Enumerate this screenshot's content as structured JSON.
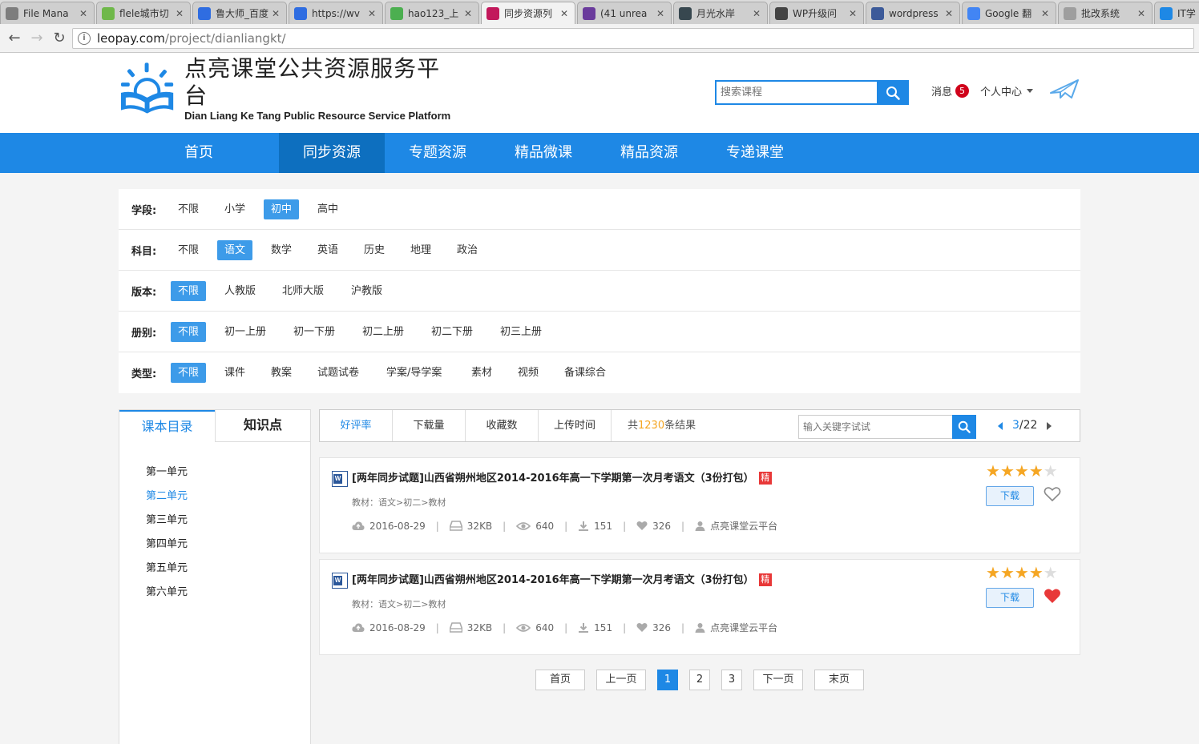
{
  "browser": {
    "tabs": [
      {
        "title": "File Mana",
        "color": "#7d7d7d"
      },
      {
        "title": "flele城市切",
        "color": "#6fb84a"
      },
      {
        "title": "鲁大师_百度",
        "color": "#2f6de1"
      },
      {
        "title": "https://wv",
        "color": "#2f6de1"
      },
      {
        "title": "hao123_上",
        "color": "#4caf50"
      },
      {
        "title": "同步资源列",
        "color": "#c2185b"
      },
      {
        "title": "(41 unrea",
        "color": "#6a3b9c"
      },
      {
        "title": "月光水岸",
        "color": "#37474f"
      },
      {
        "title": "WP升级问",
        "color": "#444444"
      },
      {
        "title": "wordpress",
        "color": "#3c5a99"
      },
      {
        "title": "Google 翻",
        "color": "#4285f4"
      },
      {
        "title": "批改系统",
        "color": "#9e9e9e"
      },
      {
        "title": "IT学",
        "color": "#1e88e5"
      }
    ],
    "active_tab": 5,
    "url_host": "leopay.com",
    "url_path": "/project/dianliangkt/"
  },
  "header": {
    "logo_cn": "点亮课堂公共资源服务平台",
    "logo_en": "Dian Liang Ke Tang Public Resource Service Platform",
    "search_placeholder": "搜索课程",
    "messages_label": "消息",
    "messages_count": "5",
    "user_center": "个人中心"
  },
  "nav": [
    {
      "label": "首页",
      "active": false
    },
    {
      "label": "同步资源",
      "active": true
    },
    {
      "label": "专题资源",
      "active": false
    },
    {
      "label": "精品微课",
      "active": false
    },
    {
      "label": "精品资源",
      "active": false
    },
    {
      "label": "专递课堂",
      "active": false
    }
  ],
  "filters": [
    {
      "label": "学段:",
      "options": [
        "不限",
        "小学",
        "初中",
        "高中"
      ],
      "selected": 2
    },
    {
      "label": "科目:",
      "options": [
        "不限",
        "语文",
        "数学",
        "英语",
        "历史",
        "地理",
        "政治"
      ],
      "selected": 1
    },
    {
      "label": "版本:",
      "options": [
        "不限",
        "人教版",
        "北师大版",
        "沪教版"
      ],
      "selected": 0
    },
    {
      "label": "册别:",
      "options": [
        "不限",
        "初一上册",
        "初一下册",
        "初二上册",
        "初二下册",
        "初三上册"
      ],
      "selected": 0
    },
    {
      "label": "类型:",
      "options": [
        "不限",
        "课件",
        "教案",
        "试题试卷",
        "学案/导学案",
        "素材",
        "视频",
        "备课综合"
      ],
      "selected": 0
    }
  ],
  "sidebar": {
    "tab_catalog": "课本目录",
    "tab_knowledge": "知识点",
    "units": [
      "第一单元",
      "第二单元",
      "第三单元",
      "第四单元",
      "第五单元",
      "第六单元"
    ],
    "selected_unit": 1
  },
  "sortbar": {
    "options": [
      "好评率",
      "下载量",
      "收藏数",
      "上传时间"
    ],
    "selected": 0,
    "total_prefix": "共",
    "total_count": "1230",
    "total_suffix": "条结果",
    "keyword_placeholder": "输入关键字试试",
    "page_current": "3",
    "page_total": "/22"
  },
  "results": [
    {
      "title": "[两年同步试题]山西省朔州地区2014-2016年高一下学期第一次月考语文（3份打包）",
      "badge": "精",
      "path": "教材：语文>初二>教材",
      "date": "2016-08-29",
      "size": "32KB",
      "views": "640",
      "downloads": "151",
      "likes": "326",
      "uploader": "点亮课堂云平台",
      "rating": 4,
      "max_rating": 5,
      "download_label": "下载",
      "favorited": false
    },
    {
      "title": "[两年同步试题]山西省朔州地区2014-2016年高一下学期第一次月考语文（3份打包）",
      "badge": "精",
      "path": "教材：语文>初二>教材",
      "date": "2016-08-29",
      "size": "32KB",
      "views": "640",
      "downloads": "151",
      "likes": "326",
      "uploader": "点亮课堂云平台",
      "rating": 4,
      "max_rating": 5,
      "download_label": "下载",
      "favorited": true
    }
  ],
  "pagination": {
    "first": "首页",
    "prev": "上一页",
    "pages": [
      "1",
      "2",
      "3"
    ],
    "current": 0,
    "next": "下一页",
    "last": "末页"
  },
  "colors": {
    "primary": "#1e88e5",
    "star_on": "#f5a623",
    "star_off": "#dddddd",
    "heart_on": "#e83838",
    "badge_red": "#d0021b"
  }
}
